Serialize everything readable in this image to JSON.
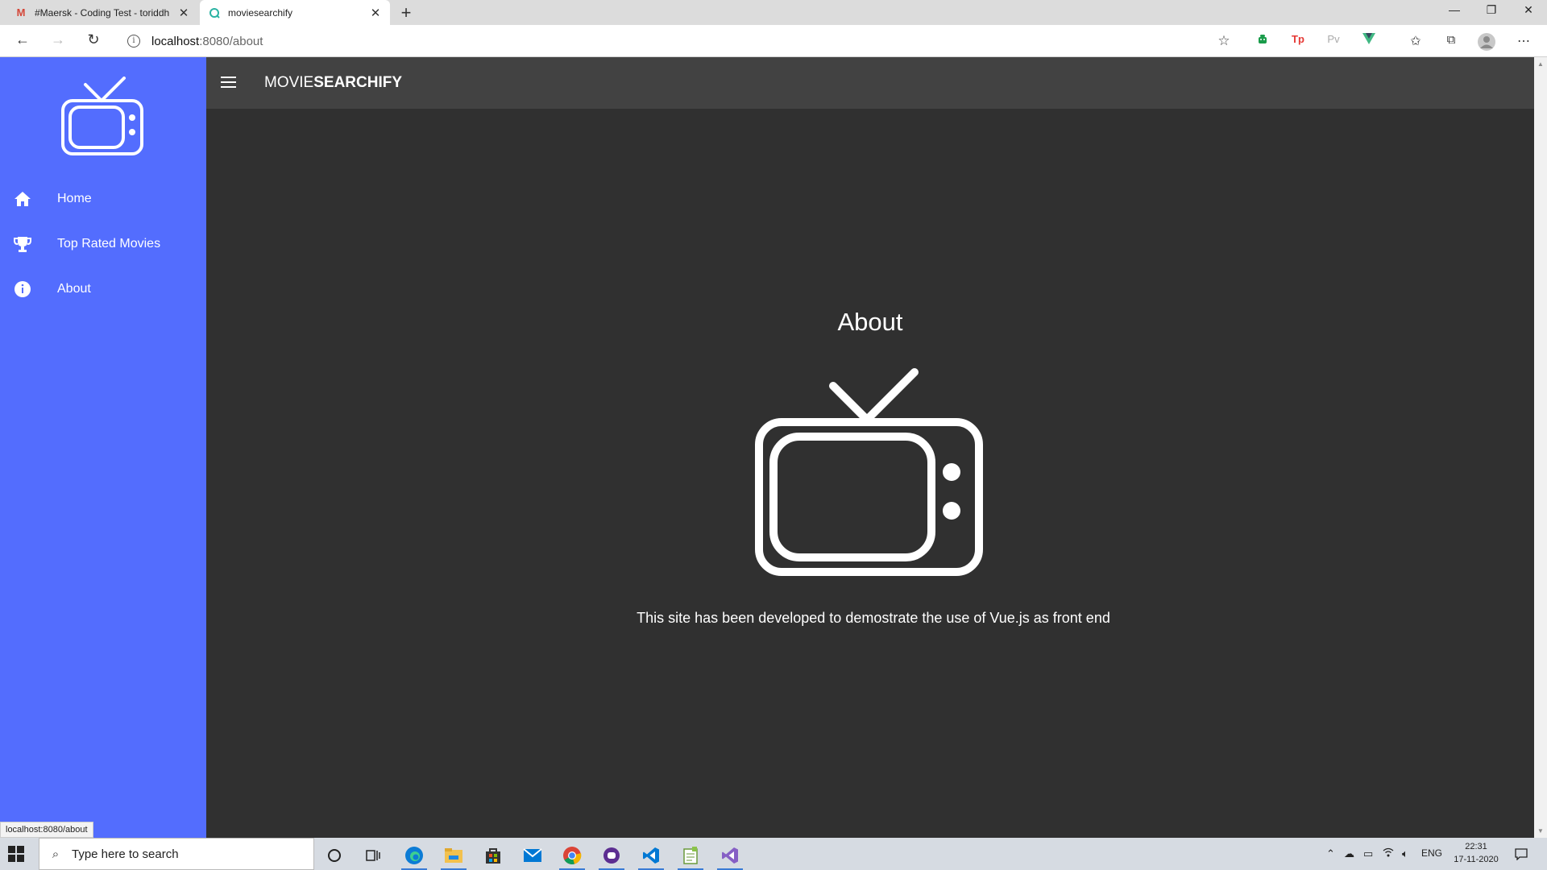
{
  "browser": {
    "tabs": [
      {
        "title": "#Maersk - Coding Test - toriddh",
        "icon": "gmail-icon",
        "active": false
      },
      {
        "title": "moviesearchify",
        "icon": "site-favicon",
        "active": true
      }
    ],
    "address": {
      "host": "localhost",
      "path": ":8080/about"
    },
    "status_url": "localhost:8080/about",
    "extensions": [
      "Tp",
      "Pv"
    ]
  },
  "app": {
    "brand_light": "MOVIE",
    "brand_bold": "SEARCHIFY",
    "sidebar_color": "#536dfe",
    "nav": [
      {
        "label": "Home",
        "icon": "home-icon"
      },
      {
        "label": "Top Rated Movies",
        "icon": "trophy-icon"
      },
      {
        "label": "About",
        "icon": "info-icon"
      }
    ]
  },
  "page": {
    "title": "About",
    "text": "This site has been developed to demostrate the use of Vue.js as front end"
  },
  "taskbar": {
    "search_placeholder": "Type here to search",
    "lang": "ENG",
    "time": "22:31",
    "date": "17-11-2020"
  }
}
